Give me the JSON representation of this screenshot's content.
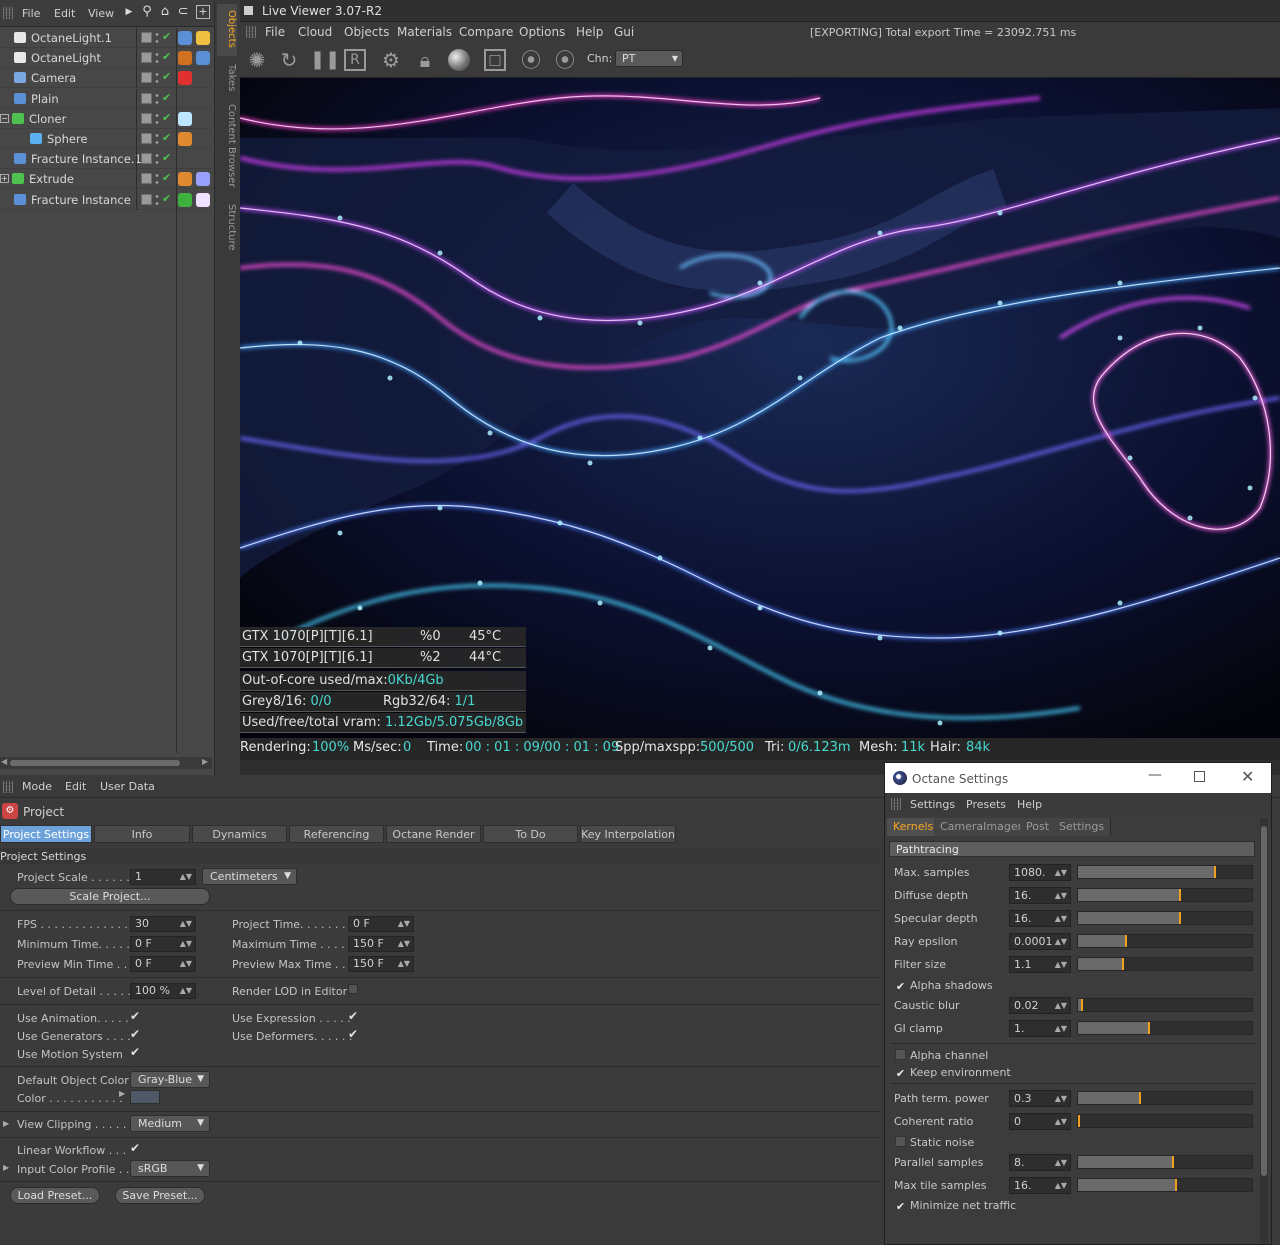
{
  "object_manager": {
    "menu": {
      "file": "File",
      "edit": "Edit",
      "view": "View"
    },
    "objects": [
      {
        "name": "OctaneLight.1",
        "indent": 1,
        "icon_color": "#e8e8e8",
        "tag": "#5b8fd6",
        "tag2": "#f0c040"
      },
      {
        "name": "OctaneLight",
        "indent": 1,
        "icon_color": "#e8e8e8",
        "tag": "#d07020",
        "tag2": "#5b8fd6"
      },
      {
        "name": "Camera",
        "indent": 1,
        "icon_color": "#7aa7e0",
        "tag": "#e03030",
        "tag2": ""
      },
      {
        "name": "Plain",
        "indent": 1,
        "icon_color": "#5b8fd6",
        "tag": "",
        "tag2": ""
      },
      {
        "name": "Cloner",
        "indent": 0,
        "icon_color": "#4fc14f",
        "tag": "#bfe6ff",
        "tag2": ""
      },
      {
        "name": "Sphere",
        "indent": 2,
        "icon_color": "#5bb0f0",
        "tag": "#e08a30",
        "tag2": ""
      },
      {
        "name": "Fracture Instance.1",
        "indent": 0,
        "icon_color": "#5b8fd6",
        "tag": "",
        "tag2": ""
      },
      {
        "name": "Extrude",
        "indent": 0,
        "icon_color": "#4fc14f",
        "tag": "#e08a30",
        "tag2": "#9aa0ff"
      },
      {
        "name": "Fracture Instance",
        "indent": 0,
        "icon_color": "#5b8fd6",
        "tag": "#3fb040",
        "tag2": "#f0e0ff"
      }
    ],
    "vtabs": {
      "objects": "Objects",
      "takes": "Takes",
      "content_browser": "Content Browser",
      "structure": "Structure"
    }
  },
  "live_viewer": {
    "title": "Live Viewer 3.07-R2",
    "menu": [
      "File",
      "Cloud",
      "Objects",
      "Materials",
      "Compare",
      "Options",
      "Help",
      "Gui"
    ],
    "export_status": "[EXPORTING] Total export Time = 23092.751 ms",
    "channel_label": "Chn:",
    "channel_value": "PT",
    "gpu_rows": [
      {
        "name": "GTX 1070[P][T][6.1]",
        "pct": "%0",
        "temp": "45°C"
      },
      {
        "name": "GTX 1070[P][T][6.1]",
        "pct": "%2",
        "temp": "44°C"
      }
    ],
    "out_of_core": {
      "label": "Out-of-core used/max:",
      "value": "0Kb/4Gb"
    },
    "grey": {
      "label": "Grey8/16:",
      "value": "0/0"
    },
    "rgb": {
      "label": "Rgb32/64:",
      "value": "1/1"
    },
    "vram": {
      "label": "Used/free/total vram:",
      "value": "1.12Gb/5.075Gb/8Gb"
    },
    "status": {
      "rendering_label": "Rendering:",
      "rendering": "100%",
      "ms_label": "Ms/sec:",
      "ms": "0",
      "time_label": "Time:",
      "time": "00 : 01 : 09/00 : 01 : 09",
      "spp_label": "Spp/maxspp:",
      "spp": "500/500",
      "tri_label": "Tri:",
      "tri": "0/6.123m",
      "mesh_label": "Mesh:",
      "mesh": "11k",
      "hair_label": "Hair:",
      "hair": "84k"
    }
  },
  "attributes": {
    "menu": {
      "mode": "Mode",
      "edit": "Edit",
      "user_data": "User Data"
    },
    "object_title": "Project",
    "tabs": [
      "Project Settings",
      "Info",
      "Dynamics",
      "Referencing",
      "Octane Render",
      "To Do",
      "Key Interpolation"
    ],
    "section": "Project Settings",
    "project_scale": {
      "label": "Project Scale . . . . . .",
      "value": "1",
      "unit": "Centimeters"
    },
    "scale_button": "Scale Project...",
    "fps": {
      "label": "FPS . . . . . . . . . . . . . .",
      "value": "30"
    },
    "project_time": {
      "label": "Project Time. . . . . . . .",
      "value": "0 F"
    },
    "min_time": {
      "label": "Minimum Time. . . . . .",
      "value": "0 F"
    },
    "max_time": {
      "label": "Maximum Time . . . . .",
      "value": "150 F"
    },
    "prev_min": {
      "label": "Preview Min Time . . .",
      "value": "0 F"
    },
    "prev_max": {
      "label": "Preview Max Time . . .",
      "value": "150 F"
    },
    "lod": {
      "label": "Level of Detail . . . . .",
      "value": "100 %"
    },
    "render_lod": "Render LOD in Editor",
    "use_animation": "Use Animation. . . . .",
    "use_expression": "Use Expression . . . . .",
    "use_generators": "Use Generators . . . .",
    "use_deformers": "Use Deformers. . . . . .",
    "use_motion": "Use Motion System",
    "default_color": {
      "label": "Default Object Color",
      "value": "Gray-Blue"
    },
    "color_label": "Color . . . . . . . . . . .",
    "view_clipping": {
      "label": "View Clipping . . . . .",
      "value": "Medium"
    },
    "linear_workflow": "Linear Workflow . . .",
    "input_profile": {
      "label": "Input Color Profile . .",
      "value": "sRGB"
    },
    "load_preset": "Load Preset...",
    "save_preset": "Save Preset..."
  },
  "octane_settings": {
    "title": "Octane Settings",
    "menu": [
      "Settings",
      "Presets",
      "Help"
    ],
    "tabs": [
      "Kernels",
      "CameraImager",
      "Post",
      "Settings"
    ],
    "section": "Pathtracing",
    "params": [
      {
        "label": "Max. samples",
        "value": "1080.",
        "level": 0.78
      },
      {
        "label": "Diffuse depth",
        "value": "16.",
        "level": 0.58
      },
      {
        "label": "Specular depth",
        "value": "16.",
        "level": 0.58
      },
      {
        "label": "Ray epsilon",
        "value": "0.0001",
        "level": 0.27
      },
      {
        "label": "Filter size",
        "value": "1.1",
        "level": 0.25
      }
    ],
    "alpha_shadows": "Alpha shadows",
    "params2": [
      {
        "label": "Caustic blur",
        "value": "0.02",
        "level": 0.02
      },
      {
        "label": "GI clamp",
        "value": "1.",
        "level": 0.4
      }
    ],
    "alpha_channel": "Alpha channel",
    "keep_environment": "Keep environment",
    "params3": [
      {
        "label": "Path term. power",
        "value": "0.3",
        "level": 0.35
      },
      {
        "label": "Coherent ratio",
        "value": "0",
        "level": 0.0
      }
    ],
    "static_noise": "Static noise",
    "params4": [
      {
        "label": "Parallel samples",
        "value": "8.",
        "level": 0.54
      },
      {
        "label": "Max tile samples",
        "value": "16.",
        "level": 0.56
      }
    ],
    "minimize_net": "Minimize net traffic",
    "colors": {
      "accent": "#f5a623",
      "tab_active": "#6da3da",
      "cyan_stat": "#47d9d0"
    }
  }
}
